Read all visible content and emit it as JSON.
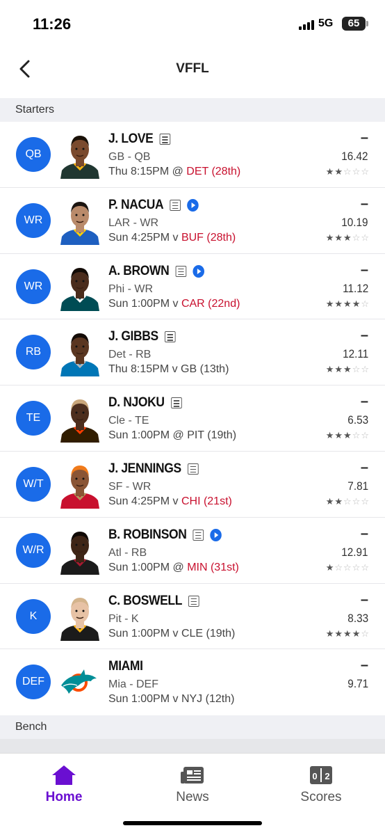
{
  "status_bar": {
    "time": "11:26",
    "network": "5G",
    "battery": "65"
  },
  "header": {
    "title": "VFFL",
    "back_icon": "chevron-left-icon"
  },
  "sections": {
    "starters": "Starters",
    "bench": "Bench"
  },
  "players": [
    {
      "pos": "QB",
      "name": "J. LOVE",
      "video": false,
      "team": "GB - QB",
      "game_pre": "Thu 8:15PM @ ",
      "game_opp": "DET (28th)",
      "opp_red": true,
      "dash": "–",
      "proj": "16.42",
      "stars": 2,
      "photo": {
        "skin": "#7a4a2e",
        "hair": "#1a1108",
        "jersey": "#203731",
        "trim": "#ffb612"
      }
    },
    {
      "pos": "WR",
      "name": "P. NACUA",
      "video": true,
      "team": "LAR - WR",
      "game_pre": "Sun 4:25PM v ",
      "game_opp": "BUF (28th)",
      "opp_red": true,
      "dash": "–",
      "proj": "10.19",
      "stars": 3,
      "photo": {
        "skin": "#b98a6a",
        "hair": "#1a1410",
        "jersey": "#1e5fc0",
        "trim": "#ffd100"
      }
    },
    {
      "pos": "WR",
      "name": "A. BROWN",
      "video": true,
      "team": "Phi - WR",
      "game_pre": "Sun 1:00PM v ",
      "game_opp": "CAR (22nd)",
      "opp_red": true,
      "dash": "–",
      "proj": "11.12",
      "stars": 4,
      "photo": {
        "skin": "#4a2c1c",
        "hair": "#120b06",
        "jersey": "#004c54",
        "trim": "#ffffff"
      }
    },
    {
      "pos": "RB",
      "name": "J. GIBBS",
      "video": false,
      "team": "Det - RB",
      "game_pre": "Thu 8:15PM v ",
      "game_opp": "GB (13th)",
      "opp_red": false,
      "dash": "–",
      "proj": "12.11",
      "stars": 3,
      "photo": {
        "skin": "#5a3621",
        "hair": "#140c07",
        "jersey": "#0076b6",
        "trim": "#b0b7bc"
      }
    },
    {
      "pos": "TE",
      "name": "D. NJOKU",
      "video": false,
      "team": "Cle - TE",
      "game_pre": "Sun 1:00PM @ ",
      "game_opp": "PIT (19th)",
      "opp_red": false,
      "dash": "–",
      "proj": "6.53",
      "stars": 3,
      "photo": {
        "skin": "#4d2e1d",
        "hair": "#c9a67a",
        "jersey": "#311d00",
        "trim": "#ff3c00"
      }
    },
    {
      "pos": "W/T",
      "name": "J. JENNINGS",
      "video": false,
      "team": "SF - WR",
      "game_pre": "Sun 4:25PM v ",
      "game_opp": "CHI (21st)",
      "opp_red": true,
      "dash": "–",
      "proj": "7.81",
      "stars": 2,
      "photo": {
        "skin": "#8a5535",
        "hair": "#f07a1a",
        "jersey": "#c8102e",
        "trim": "#b3995d"
      }
    },
    {
      "pos": "W/R",
      "name": "B. ROBINSON",
      "video": true,
      "team": "Atl - RB",
      "game_pre": "Sun 1:00PM @ ",
      "game_opp": "MIN (31st)",
      "opp_red": true,
      "dash": "–",
      "proj": "12.91",
      "stars": 1,
      "photo": {
        "skin": "#3e2516",
        "hair": "#0f0905",
        "jersey": "#1b1b1b",
        "trim": "#a71930"
      }
    },
    {
      "pos": "K",
      "name": "C. BOSWELL",
      "video": false,
      "team": "Pit - K",
      "game_pre": "Sun 1:00PM v ",
      "game_opp": "CLE (19th)",
      "opp_red": false,
      "dash": "–",
      "proj": "8.33",
      "stars": 4,
      "photo": {
        "skin": "#e7c2a5",
        "hair": "#d4b48c",
        "jersey": "#1b1b1b",
        "trim": "#ffb612"
      }
    },
    {
      "pos": "DEF",
      "name": "MIAMI",
      "video": false,
      "team": "Mia - DEF",
      "game_pre": "Sun 1:00PM v ",
      "game_opp": "NYJ (12th)",
      "opp_red": false,
      "dash": "–",
      "proj": "9.71",
      "stars": 0,
      "logo": "dolphin-logo",
      "photo": {
        "skin": "#008e97",
        "hair": "#fc4c02",
        "jersey": "#ffffff",
        "trim": "#008e97"
      }
    }
  ],
  "tabs": [
    {
      "label": "Home",
      "icon": "home-icon",
      "active": true
    },
    {
      "label": "News",
      "icon": "news-icon",
      "active": false
    },
    {
      "label": "Scores",
      "icon": "scores-icon",
      "active": false
    }
  ],
  "colors": {
    "accent": "#1a6be8",
    "active_tab": "#6a0fd1",
    "opponent_rank_bad": "#c8102e"
  }
}
